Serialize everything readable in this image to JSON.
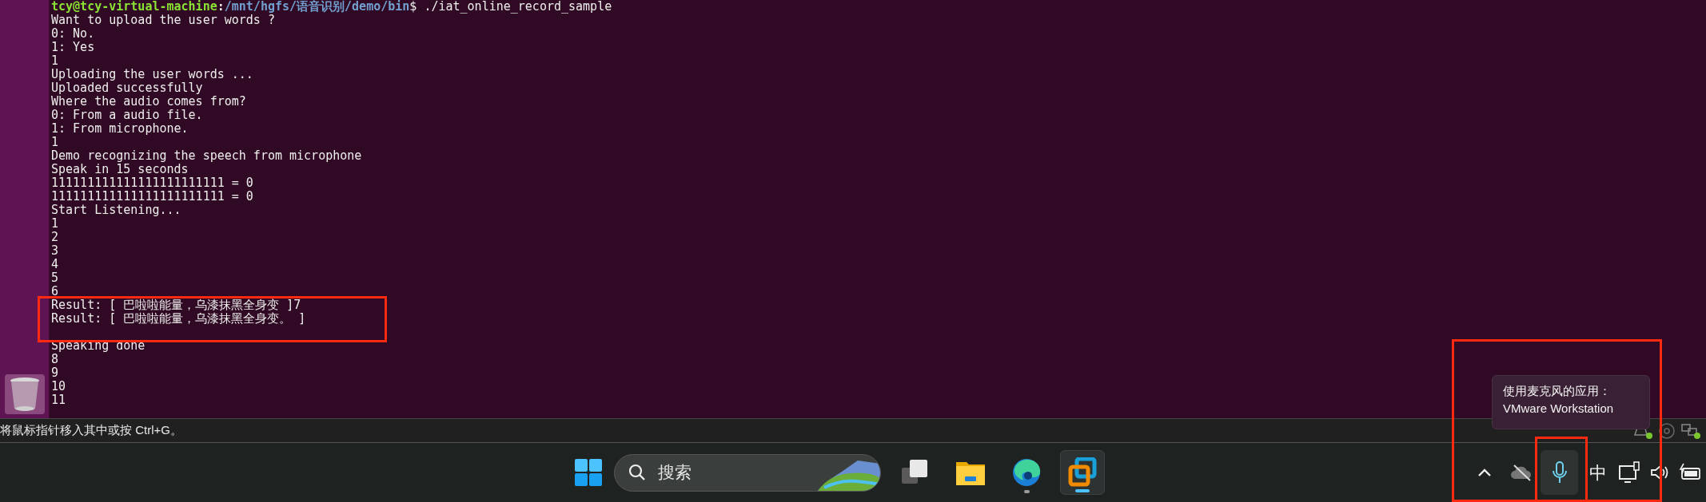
{
  "terminal": {
    "prompt": {
      "user_host": "tcy@tcy-virtual-machine",
      "separator": ":",
      "path": "/mnt/hgfs/语音识别/demo/bin",
      "command": "$ ./iat_online_record_sample"
    },
    "lines": [
      "Want to upload the user words ?",
      "0: No.",
      "1: Yes",
      "1",
      "Uploading the user words ...",
      "Uploaded successfully",
      "Where the audio comes from?",
      "0: From a audio file.",
      "1: From microphone.",
      "1",
      "Demo recognizing the speech from microphone",
      "Speak in 15 seconds",
      "111111111111111111111111 = 0",
      "111111111111111111111111 = 0",
      "Start Listening...",
      "1",
      "2",
      "3",
      "4",
      "5",
      "6"
    ],
    "results": [
      "Result: [ 巴啦啦能量，乌漆抹黑全身变 ]7",
      "Result: [ 巴啦啦能量，乌漆抹黑全身变。 ]"
    ],
    "lines_after": [
      "Speaking done",
      "8",
      "9",
      "10",
      "11"
    ]
  },
  "status_bar": {
    "hint": "将鼠标指针移入其中或按 Ctrl+G。"
  },
  "tooltip": {
    "lines": [
      "使用麦克风的应用：",
      "VMware Workstation"
    ]
  },
  "taskbar": {
    "search": {
      "placeholder": "搜索"
    },
    "apps": [
      {
        "kind": "task-view",
        "running": false,
        "selected": false
      },
      {
        "kind": "folder",
        "running": false,
        "selected": false
      },
      {
        "kind": "browser",
        "running": true,
        "selected": false
      },
      {
        "kind": "vmware",
        "running": true,
        "selected": true
      }
    ],
    "tray": {
      "input_method": "中"
    }
  }
}
